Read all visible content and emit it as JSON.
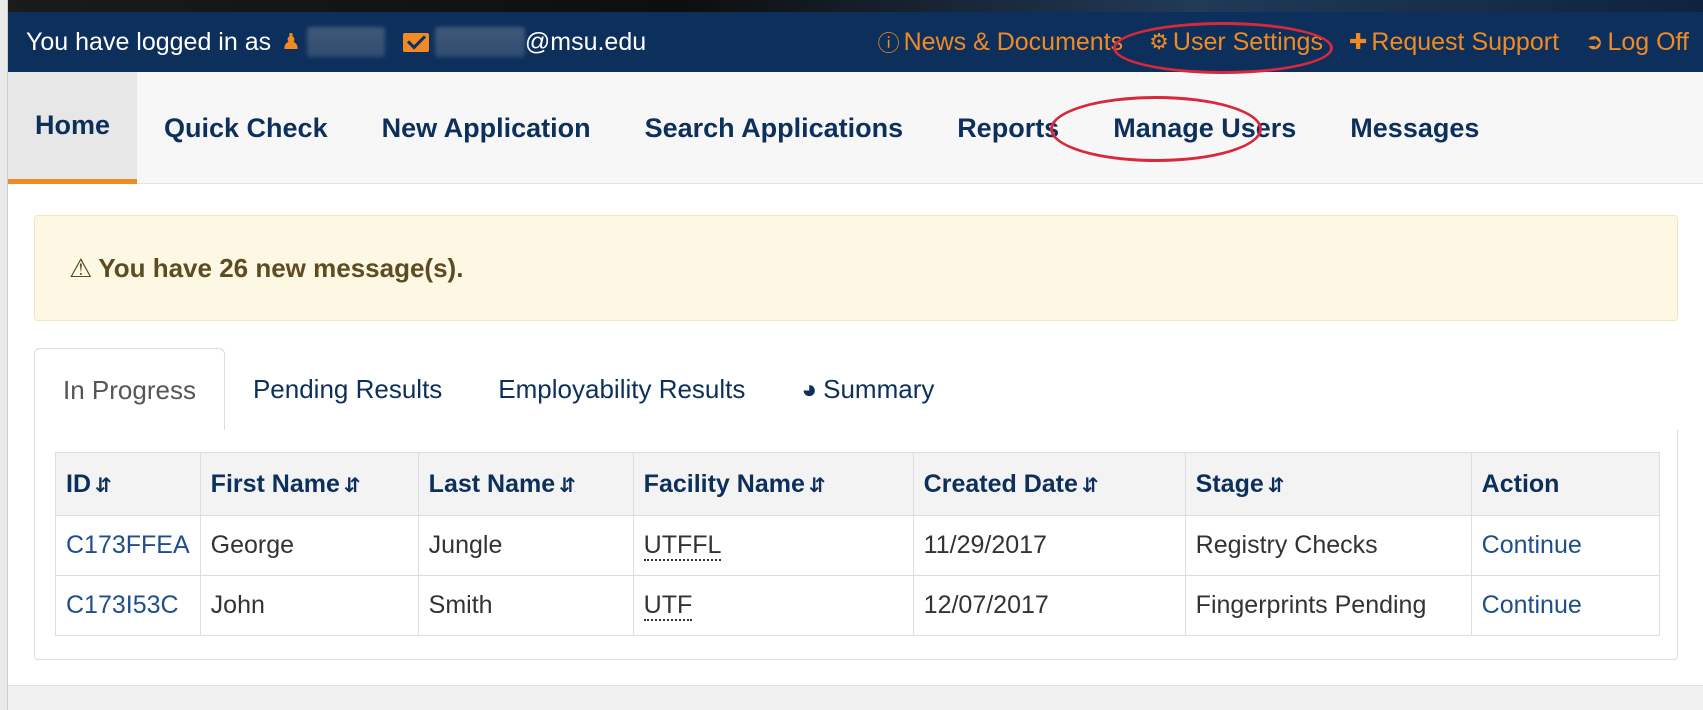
{
  "topbar": {
    "login_prefix": "You have logged in as",
    "email_suffix": "@msu.edu",
    "links": [
      {
        "label": "News & Documents",
        "icon": "info-circle-icon"
      },
      {
        "label": "User Settings",
        "icon": "cogs-icon"
      },
      {
        "label": "Request Support",
        "icon": "puzzle-icon"
      },
      {
        "label": "Log Off",
        "icon": "sign-out-icon"
      }
    ]
  },
  "nav": [
    "Home",
    "Quick Check",
    "New Application",
    "Search Applications",
    "Reports",
    "Manage Users",
    "Messages"
  ],
  "alert": {
    "text": "You have 26 new message(s)."
  },
  "tabs": [
    "In Progress",
    "Pending Results",
    "Employability Results",
    "Summary"
  ],
  "table": {
    "columns": [
      "ID",
      "First Name",
      "Last Name",
      "Facility Name",
      "Created Date",
      "Stage",
      "Action"
    ],
    "rows": [
      {
        "id": "C173FFEA",
        "first": "George",
        "last": "Jungle",
        "facility": "UTFFL",
        "created": "11/29/2017",
        "stage": "Registry Checks",
        "action": "Continue"
      },
      {
        "id": "C173I53C",
        "first": "John",
        "last": "Smith",
        "facility": "UTF",
        "created": "12/07/2017",
        "stage": "Fingerprints Pending",
        "action": "Continue"
      }
    ]
  },
  "colors": {
    "brand": "#0c2f5c",
    "accent": "#f08a24",
    "highlight": "#d8283b"
  }
}
